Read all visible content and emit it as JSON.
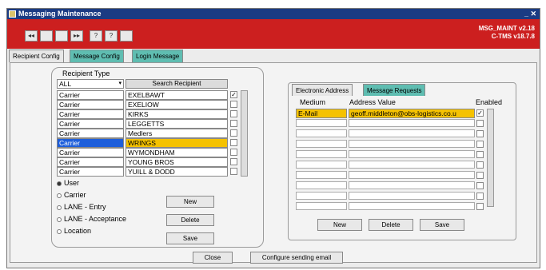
{
  "window": {
    "title": "Messaging Maintenance"
  },
  "banner": {
    "version1": "MSG_MAINT v2.18",
    "version2": "C-TMS v18.7.8"
  },
  "toolbar": {
    "b1": "◂◂",
    "b2": "",
    "b3": "",
    "b4": "▸▸",
    "b5": "?",
    "b6": "?",
    "b7": ""
  },
  "tabs": [
    "Recipient Config",
    "Message Config",
    "Login Message"
  ],
  "recipient": {
    "type_label": "Recipient Type",
    "filter_value": "ALL",
    "search_button": "Search Recipient",
    "rows": [
      {
        "type": "Carrier",
        "name": "EXELBAWT",
        "checked": true
      },
      {
        "type": "Carrier",
        "name": "EXELIOW",
        "checked": false
      },
      {
        "type": "Carrier",
        "name": "KIRKS",
        "checked": false
      },
      {
        "type": "Carrier",
        "name": "LEGGETTS",
        "checked": false
      },
      {
        "type": "Carrier",
        "name": "Medlers",
        "checked": false
      },
      {
        "type": "Carrier",
        "name": "WRINGS",
        "checked": false
      },
      {
        "type": "Carrier",
        "name": "WYMONDHAM",
        "checked": false
      },
      {
        "type": "Carrier",
        "name": "YOUNG BROS",
        "checked": false
      },
      {
        "type": "Carrier",
        "name": "YUILL & DODD",
        "checked": false
      }
    ],
    "radios": [
      "User",
      "Carrier",
      "LANE - Entry",
      "LANE - Acceptance",
      "Location"
    ],
    "new_button": "New",
    "delete_button": "Delete",
    "save_button": "Save"
  },
  "address": {
    "tab1": "Electronic Address",
    "tab2": "Message Requests",
    "col_medium": "Medium",
    "col_address": "Address Value",
    "col_enabled": "Enabled",
    "row_medium": "E-Mail",
    "row_address": "geoff.middleton@obs-logistics.co.u",
    "new_button": "New",
    "delete_button": "Delete",
    "save_button": "Save"
  },
  "footer": {
    "close_button": "Close",
    "configure_button": "Configure sending email"
  }
}
